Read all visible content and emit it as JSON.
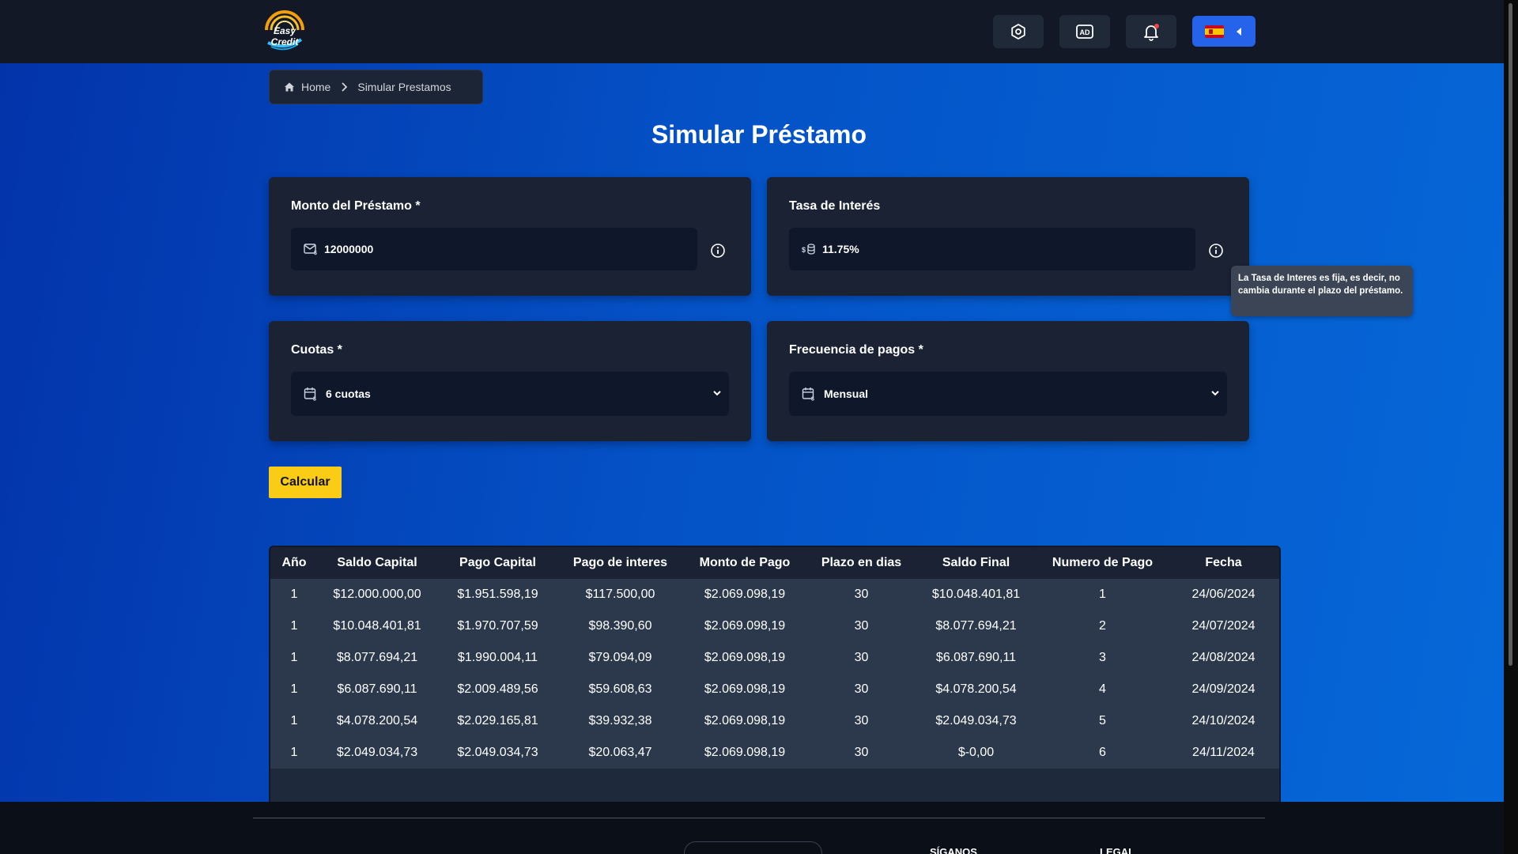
{
  "header": {
    "logo_text": "Easy Credit",
    "buttons": [
      "settings-icon",
      "ad-icon",
      "bell-icon"
    ],
    "language_flag": "spain-flag-icon",
    "accent": "#2563eb"
  },
  "breadcrumb": {
    "home": "Home",
    "current": "Simular Prestamos"
  },
  "page_title": "Simular Préstamo",
  "form": {
    "amount": {
      "label": "Monto del Préstamo *",
      "value": "12000000"
    },
    "rate": {
      "label": "Tasa de Interés",
      "value": "11.75%"
    },
    "installments": {
      "label": "Cuotas *",
      "value": "6 cuotas"
    },
    "frequency": {
      "label": "Frecuencia de pagos *",
      "value": "Mensual"
    },
    "tooltip": "La Tasa de Interes es fija, es decir, no cambia durante el plazo del préstamo.",
    "submit": "Calcular"
  },
  "table": {
    "headers": [
      "Año",
      "Saldo Capital",
      "Pago Capital",
      "Pago de interes",
      "Monto de Pago",
      "Plazo en dias",
      "Saldo Final",
      "Numero de Pago",
      "Fecha"
    ],
    "rows": [
      [
        "1",
        "$12.000.000,00",
        "$1.951.598,19",
        "$117.500,00",
        "$2.069.098,19",
        "30",
        "$10.048.401,81",
        "1",
        "24/06/2024"
      ],
      [
        "1",
        "$10.048.401,81",
        "$1.970.707,59",
        "$98.390,60",
        "$2.069.098,19",
        "30",
        "$8.077.694,21",
        "2",
        "24/07/2024"
      ],
      [
        "1",
        "$8.077.694,21",
        "$1.990.004,11",
        "$79.094,09",
        "$2.069.098,19",
        "30",
        "$6.087.690,11",
        "3",
        "24/08/2024"
      ],
      [
        "1",
        "$6.087.690,11",
        "$2.009.489,56",
        "$59.608,63",
        "$2.069.098,19",
        "30",
        "$4.078.200,54",
        "4",
        "24/09/2024"
      ],
      [
        "1",
        "$4.078.200,54",
        "$2.029.165,81",
        "$39.932,38",
        "$2.069.098,19",
        "30",
        "$2.049.034,73",
        "5",
        "24/10/2024"
      ],
      [
        "1",
        "$2.049.034,73",
        "$2.049.034,73",
        "$20.063,47",
        "$2.069.098,19",
        "30",
        "$-0,00",
        "6",
        "24/11/2024"
      ]
    ]
  },
  "footer": {
    "follow": "SÍGANOS",
    "legal": "LEGAL"
  }
}
